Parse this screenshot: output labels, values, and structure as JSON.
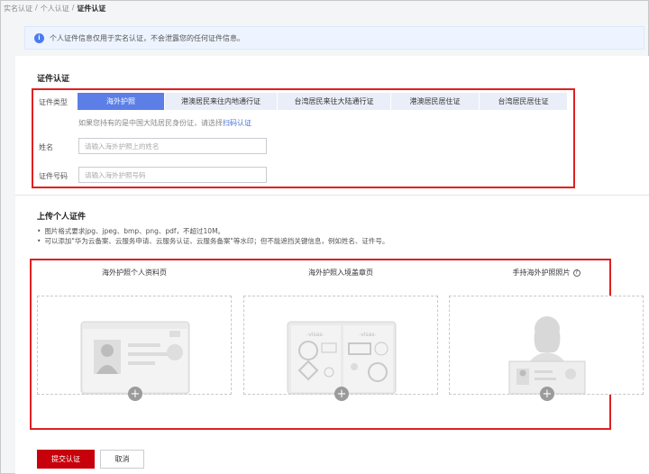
{
  "breadcrumb": {
    "items": [
      "实名认证",
      "个人认证",
      "证件认证"
    ],
    "separator": "/"
  },
  "notice": {
    "text": "个人证件信息仅用于实名认证，不会泄露您的任何证件信息。"
  },
  "cert_section": {
    "title": "证件认证",
    "type_label": "证件类型",
    "tabs": [
      "海外护照",
      "港澳居民来往内地通行证",
      "台湾居民来往大陆通行证",
      "港澳居民居住证",
      "台湾居民居住证"
    ],
    "active_tab": "海外护照",
    "hint_prefix": "如果您持有的是中国大陆居民身份证，请选择",
    "hint_link": "扫码认证",
    "name_label": "姓名",
    "name_placeholder": "请输入海外护照上的姓名",
    "number_label": "证件号码",
    "number_placeholder": "请输入海外护照号码"
  },
  "upload_section": {
    "title": "上传个人证件",
    "requirements": [
      "图片格式要求jpg、jpeg、bmp、png、pdf，不超过10M。",
      "可以添加\"华为云备案、云服务申请、云服务认证、云服务备案\"等水印；但不能遮挡关键信息，例如姓名、证件号。"
    ],
    "cards": [
      {
        "title": "海外护照个人资料页",
        "icon": "passport-photo-page-icon"
      },
      {
        "title": "海外护照入境盖章页",
        "icon": "passport-visa-stamp-page-icon"
      },
      {
        "title": "手持海外护照照片",
        "icon": "hand-held-passport-icon",
        "help": "?"
      }
    ],
    "visa_text": "-visas-"
  },
  "actions": {
    "submit_label": "提交认证",
    "cancel_label": "取消"
  },
  "colors": {
    "accent": "#5b7fe6",
    "danger": "#c7000b",
    "highlight": "#e02020"
  }
}
